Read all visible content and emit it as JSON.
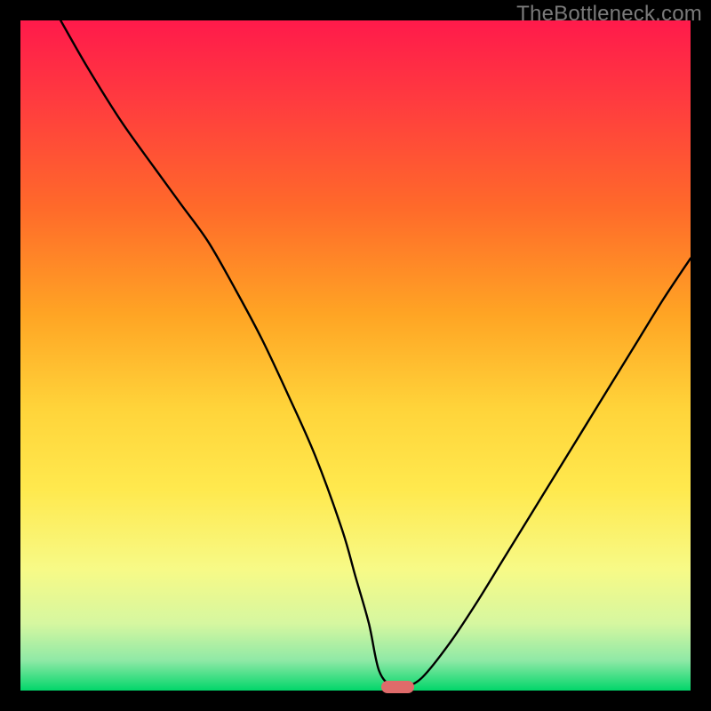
{
  "watermark": "TheBottleneck.com",
  "colors": {
    "frame": "#000000",
    "watermark": "#7a7a7a",
    "curve": "#000000",
    "marker": "#df6b6a",
    "gradient_stops": [
      {
        "offset": 0.0,
        "color": "#ff1a4b"
      },
      {
        "offset": 0.12,
        "color": "#ff3b3f"
      },
      {
        "offset": 0.28,
        "color": "#ff6a2a"
      },
      {
        "offset": 0.44,
        "color": "#ffa524"
      },
      {
        "offset": 0.58,
        "color": "#ffd43a"
      },
      {
        "offset": 0.7,
        "color": "#ffe94e"
      },
      {
        "offset": 0.82,
        "color": "#f7fa87"
      },
      {
        "offset": 0.9,
        "color": "#d6f7a0"
      },
      {
        "offset": 0.955,
        "color": "#8fe9a6"
      },
      {
        "offset": 1.0,
        "color": "#02d66a"
      }
    ]
  },
  "chart_data": {
    "type": "line",
    "title": "",
    "xlabel": "",
    "ylabel": "",
    "xlim": [
      0,
      100
    ],
    "ylim": [
      0,
      100
    ],
    "grid": false,
    "legend": false,
    "series": [
      {
        "name": "bottleneck-curve",
        "x": [
          6,
          10,
          15,
          20,
          24,
          28,
          32,
          36,
          40,
          44,
          48,
          50,
          52,
          53.5,
          55.5,
          57.5,
          60,
          64,
          68,
          72,
          76,
          80,
          84,
          88,
          92,
          96,
          100
        ],
        "y": [
          100,
          93,
          85,
          78,
          72.5,
          67,
          60,
          52.5,
          44,
          35,
          24,
          17,
          10,
          3,
          0.6,
          0.6,
          2,
          7,
          13,
          19.5,
          26,
          32.5,
          39,
          45.5,
          52,
          58.5,
          64.5
        ]
      }
    ],
    "marker": {
      "x_center": 56.3,
      "y": 0.6,
      "width_pct": 4.8
    }
  }
}
